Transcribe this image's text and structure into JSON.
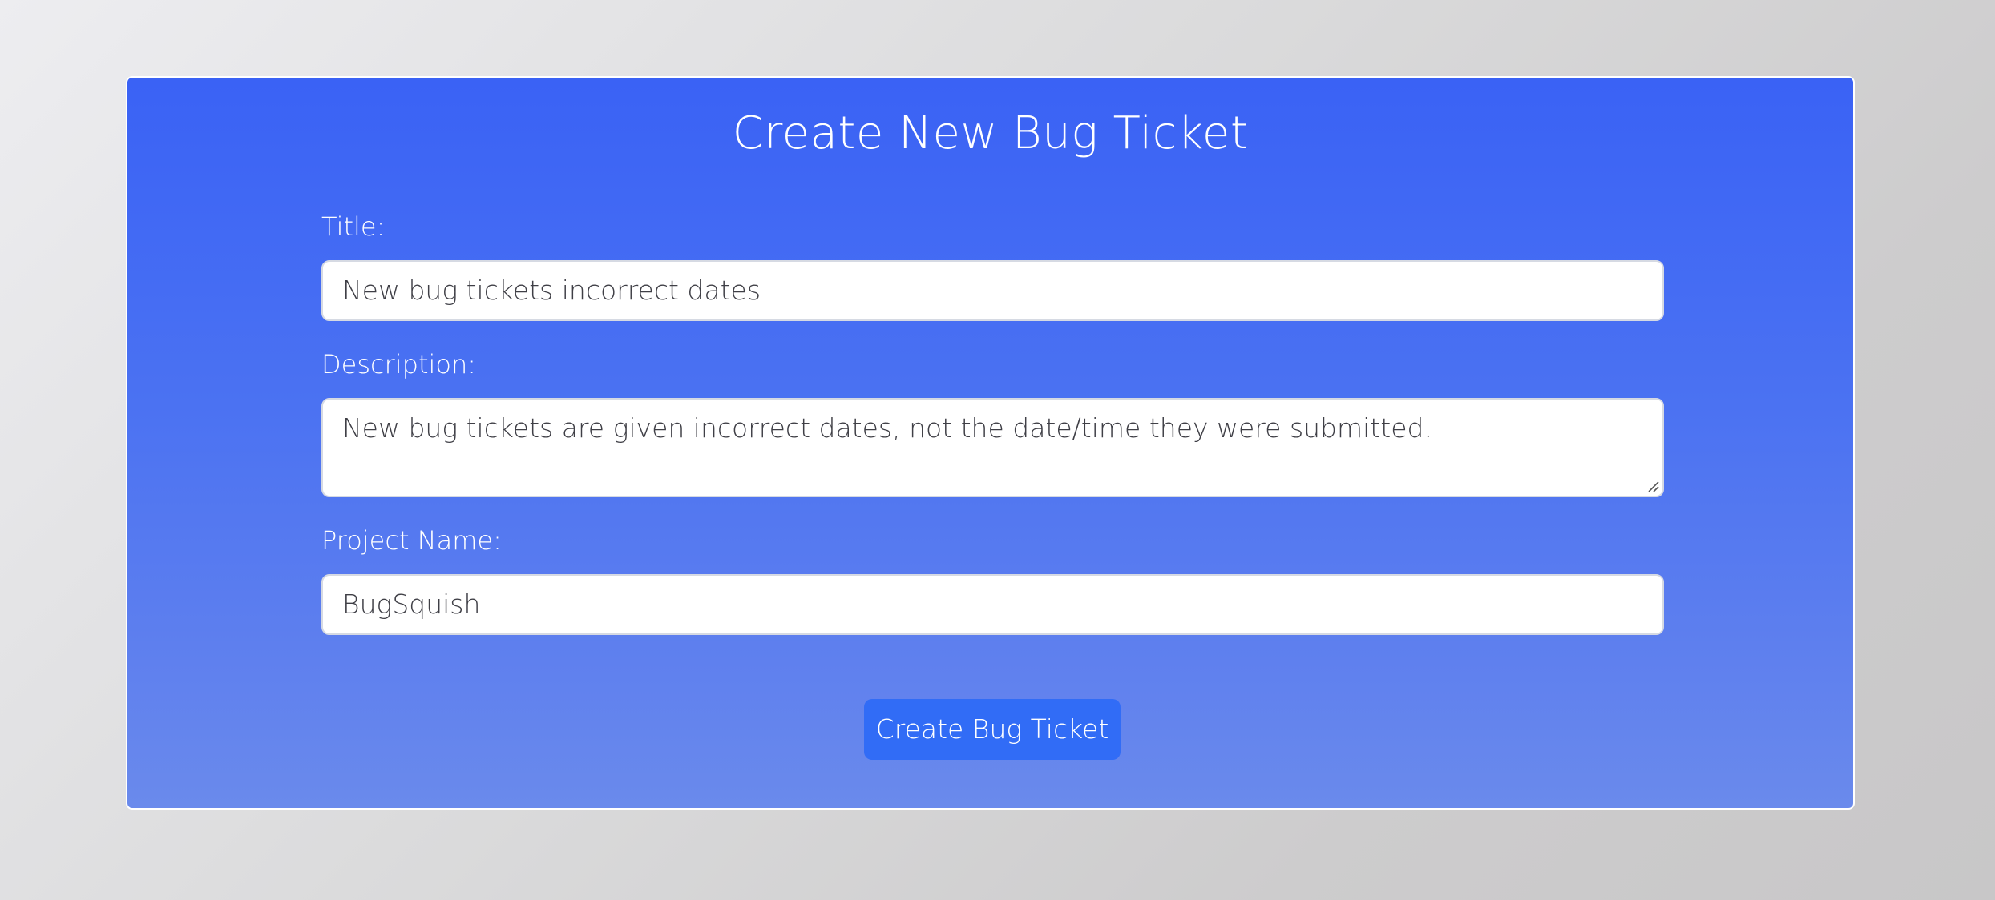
{
  "form": {
    "title": "Create New Bug Ticket",
    "fields": {
      "title": {
        "label": "Title:",
        "value": "New bug tickets incorrect dates"
      },
      "description": {
        "label": "Description:",
        "value": "New bug tickets are given incorrect dates, not the date/time they were submitted."
      },
      "project_name": {
        "label": "Project Name:",
        "value": "BugSquish"
      }
    },
    "submit_label": "Create Bug Ticket"
  },
  "colors": {
    "card_gradient_top": "#3a62f5",
    "card_gradient_bottom": "#6a8aec",
    "button": "#316cf6",
    "input_text": "#3f3f46"
  }
}
